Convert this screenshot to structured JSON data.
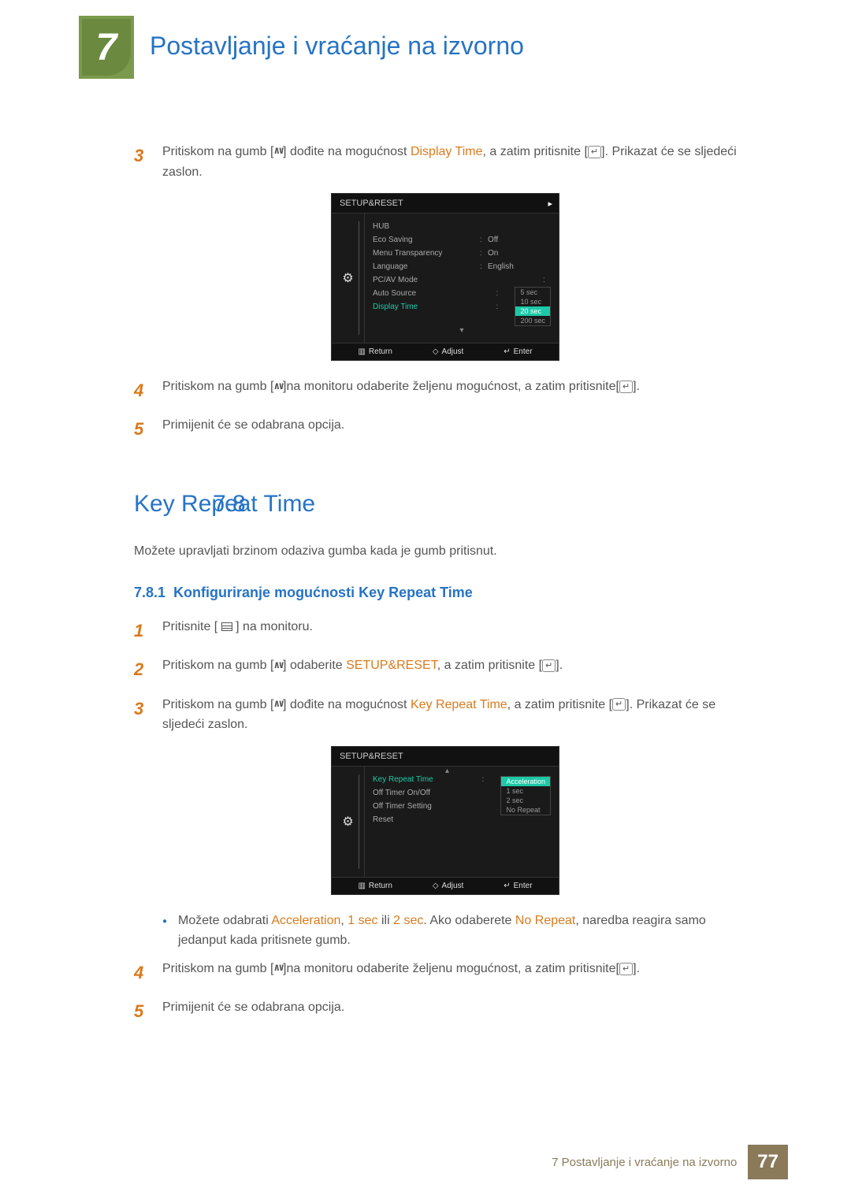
{
  "chapter": {
    "number": "7",
    "title": "Postavljanje i vraćanje na izvorno"
  },
  "topSteps": {
    "s3": {
      "num": "3",
      "pre": "Pritiskom na gumb [",
      "mid": "] dođite na mogućnost ",
      "highlight": "Display Time",
      "post1": ", a zatim pritisnite [",
      "post2": "]. Prikazat će se sljedeći zaslon."
    },
    "s4": {
      "num": "4",
      "pre": "Pritiskom na gumb [",
      "mid": "]na monitoru odaberite željenu mogućnost, a zatim pritisnite[",
      "post": "]."
    },
    "s5": {
      "num": "5",
      "text": "Primijenit će se odabrana opcija."
    }
  },
  "osd1": {
    "title": "SETUP&RESET",
    "rows": [
      {
        "label": "HUB",
        "val": ""
      },
      {
        "label": "Eco Saving",
        "val": "Off"
      },
      {
        "label": "Menu Transparency",
        "val": "On"
      },
      {
        "label": "Language",
        "val": "English"
      },
      {
        "label": "PC/AV Mode",
        "val": ""
      },
      {
        "label": "Auto Source",
        "val": ""
      }
    ],
    "selected": {
      "label": "Display Time"
    },
    "options": [
      "5 sec",
      "10 sec",
      "20 sec",
      "200 sec"
    ],
    "selectedOptionIdx": 2,
    "footer": {
      "return": "Return",
      "adjust": "Adjust",
      "enter": "Enter"
    }
  },
  "section": {
    "num": "7.8",
    "title": "Key Repeat Time",
    "desc": "Možete upravljati brzinom odaziva gumba kada je gumb pritisnut.",
    "subNum": "7.8.1",
    "subTitle": "Konfiguriranje mogućnosti Key Repeat Time"
  },
  "steps2": {
    "s1": {
      "num": "1",
      "pre": "Pritisnite [ ",
      "post": " ] na monitoru."
    },
    "s2": {
      "num": "2",
      "pre": "Pritiskom na gumb [",
      "mid": "] odaberite ",
      "highlight": "SETUP&RESET",
      "post1": ", a zatim pritisnite [",
      "post2": "]."
    },
    "s3": {
      "num": "3",
      "pre": "Pritiskom na gumb [",
      "mid": "] dođite na mogućnost ",
      "highlight": "Key Repeat Time",
      "post1": ", a zatim pritisnite [",
      "post2": "]. Prikazat će se sljedeći zaslon."
    },
    "bullet": {
      "pre": "Možete odabrati ",
      "h1": "Acceleration",
      "sep1": ", ",
      "h2": "1 sec",
      "sep2": " ili ",
      "h3": "2 sec",
      "sep3": ". Ako odaberete ",
      "h4": "No Repeat",
      "post": ", naredba reagira samo jedanput kada pritisnete gumb."
    },
    "s4": {
      "num": "4",
      "pre": "Pritiskom na gumb [",
      "mid": "]na monitoru odaberite željenu mogućnost, a zatim pritisnite[",
      "post": "]."
    },
    "s5": {
      "num": "5",
      "text": "Primijenit će se odabrana opcija."
    }
  },
  "osd2": {
    "title": "SETUP&RESET",
    "selected": {
      "label": "Key Repeat Time"
    },
    "rows": [
      {
        "label": "Off Timer On/Off"
      },
      {
        "label": "Off Timer Setting"
      },
      {
        "label": "Reset"
      }
    ],
    "options": [
      "Acceleration",
      "1 sec",
      "2 sec",
      "No Repeat"
    ],
    "selectedOptionIdx": 0,
    "footer": {
      "return": "Return",
      "adjust": "Adjust",
      "enter": "Enter"
    }
  },
  "footer": {
    "text": "7 Postavljanje i vraćanje na izvorno",
    "page": "77"
  }
}
